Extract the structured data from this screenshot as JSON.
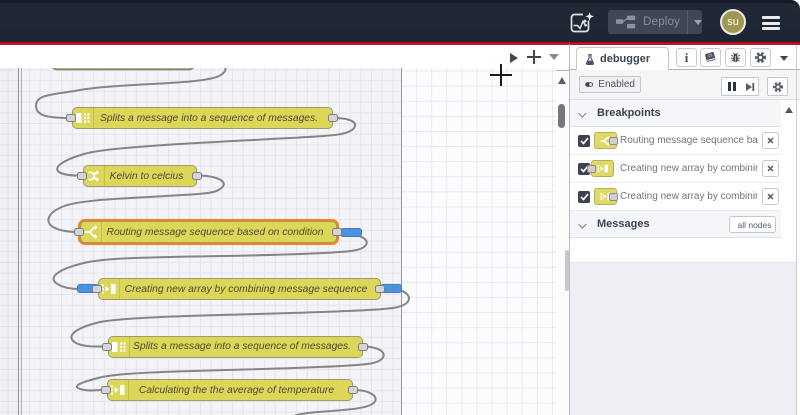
{
  "header": {
    "deploy_label": "Deploy",
    "avatar_initials": "su",
    "colors": {
      "header_bg": "#1e2532",
      "deploy_warning_line": "#c10e23",
      "avatar_bg": "#a39b51"
    }
  },
  "workspace_toolbar": {
    "controls": [
      "scroll-tabs-right",
      "add-flow",
      "list-flows"
    ]
  },
  "canvas": {
    "colors": {
      "node_fill": "#dcd659",
      "breakpoint_marker": "#4c92dd",
      "breakpoint_highlight": "#f5821f",
      "wire": "#858585"
    },
    "nodes": [
      {
        "label": "Splits a message into a sequence of messages.",
        "type": "split"
      },
      {
        "label": "Kelvin to celcius",
        "type": "change"
      },
      {
        "label": "Routing message sequence based on condition",
        "type": "switch",
        "highlighted": true,
        "breakpoint": "output"
      },
      {
        "label": "Creating new array by combining message sequence",
        "type": "join",
        "breakpoint": "input+output"
      },
      {
        "label": "Splits a message into a sequence of messages.",
        "type": "split"
      },
      {
        "label": "Calculating the the average of temperature",
        "type": "join"
      }
    ]
  },
  "sidebar": {
    "tab_label": "debugger",
    "toolbar": {
      "enabled_label": "Enabled"
    },
    "breakpoints": {
      "title": "Breakpoints",
      "rows": [
        {
          "label": "Routing message sequence based on condition",
          "checked": true,
          "node_type": "switch",
          "port": "output"
        },
        {
          "label": "Creating new array by combining message sequence",
          "checked": true,
          "node_type": "join",
          "port": "input"
        },
        {
          "label": "Creating new array by combining message sequence",
          "checked": true,
          "node_type": "join",
          "port": "output"
        }
      ]
    },
    "messages": {
      "title": "Messages",
      "filter_label": "all nodes"
    }
  }
}
